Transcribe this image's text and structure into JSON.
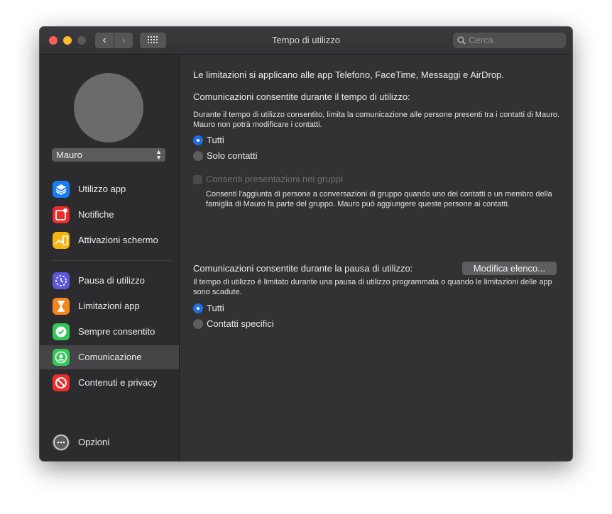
{
  "window": {
    "title": "Tempo di utilizzo",
    "nav_back": "‹",
    "nav_forward": "›",
    "search_placeholder": "Cerca"
  },
  "sidebar": {
    "user": "Mauro",
    "user_chevron": "⌃⌄",
    "items": [
      {
        "label": "Utilizzo app",
        "icon": "layers-icon",
        "color": "#1a7cf3"
      },
      {
        "label": "Notifiche",
        "icon": "notification-icon",
        "color": "#ee2b2b"
      },
      {
        "label": "Attivazioni schermo",
        "icon": "pickups-icon",
        "color": "#f6b513"
      },
      {
        "label": "Pausa di utilizzo",
        "icon": "downtime-icon",
        "color": "#5b57d9"
      },
      {
        "label": "Limitazioni app",
        "icon": "hourglass-icon",
        "color": "#f5861f"
      },
      {
        "label": "Sempre consentito",
        "icon": "checkmark-badge-icon",
        "color": "#35c659"
      },
      {
        "label": "Comunicazione",
        "icon": "contact-icon",
        "color": "#35c659"
      },
      {
        "label": "Contenuti e privacy",
        "icon": "restricted-icon",
        "color": "#ee2b2b"
      }
    ],
    "options_label": "Opzioni",
    "active_index": 6
  },
  "main": {
    "intro": "Le limitazioni si applicano alle app Telefono, FaceTime, Messaggi e AirDrop.",
    "section1": {
      "heading": "Comunicazioni consentite durante il tempo di utilizzo:",
      "description": "Durante il tempo di utilizzo consentito, limita la comunicazione alle persone presenti tra i contatti di Mauro. Mauro non potrà modificare i contatti.",
      "options": [
        "Tutti",
        "Solo contatti"
      ],
      "selected": "Tutti"
    },
    "group": {
      "checkbox_label": "Consenti presentazioni nei gruppi",
      "checked": false,
      "description": "Consenti l'aggiunta di persone a conversazioni di gruppo quando uno dei contatti o un membro della famiglia di Mauro fa parte del gruppo. Mauro può aggiungere queste persone ai contatti."
    },
    "section2": {
      "heading": "Comunicazioni consentite durante la pausa di utilizzo:",
      "button": "Modifica elenco...",
      "description": "Il tempo di utilizzo è limitato durante una pausa di utilizzo programmata o quando le limitazioni delle app sono scadute.",
      "options": [
        "Tutti",
        "Contatti specifici"
      ],
      "selected": "Tutti"
    }
  }
}
